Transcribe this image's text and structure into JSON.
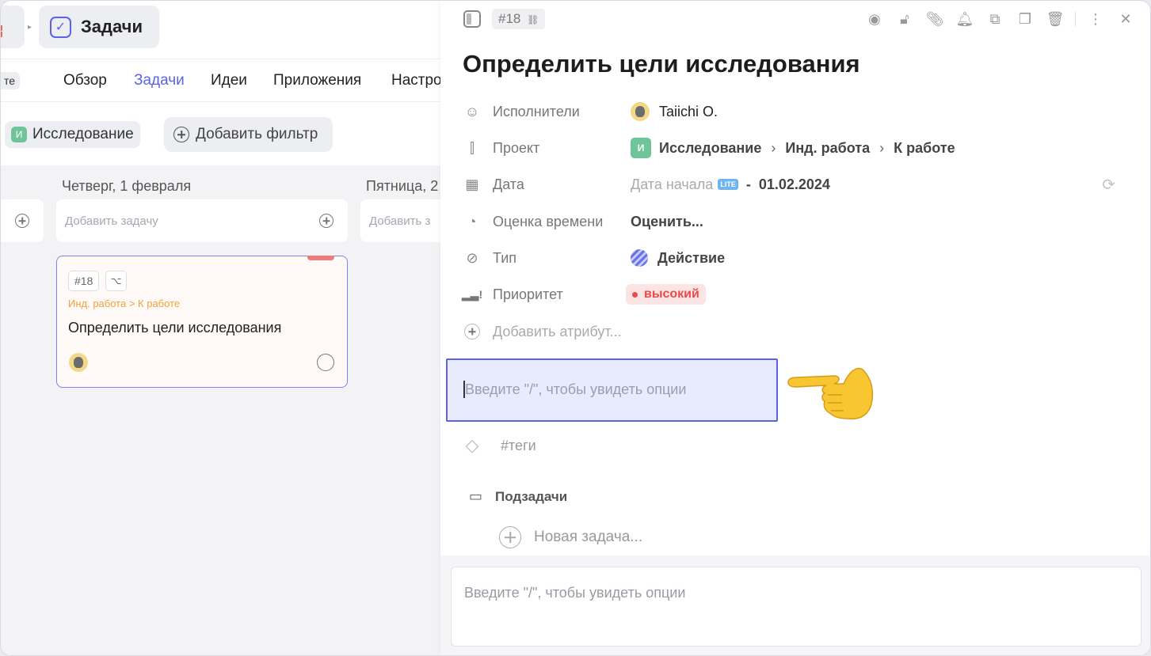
{
  "header": {
    "section_title": "Задачи",
    "stub_tag": "те"
  },
  "tabs": [
    {
      "label": "Обзор",
      "active": false
    },
    {
      "label": "Задачи",
      "active": true
    },
    {
      "label": "Идеи",
      "active": false
    },
    {
      "label": "Приложения",
      "active": false
    },
    {
      "label": "Настро",
      "active": false
    }
  ],
  "filters": {
    "project_badge": "И",
    "project_label": "Исследование",
    "add_filter_label": "Добавить фильтр"
  },
  "board": {
    "columns": [
      {
        "title": "Четверг, 1 февраля",
        "add_placeholder": "Добавить задачу"
      },
      {
        "title": "Пятница, 2",
        "add_placeholder": "Добавить з"
      }
    ],
    "card": {
      "id": "#18",
      "subtask_glyph": "⌥",
      "path": "Инд. работа > К работе",
      "title": "Определить цели исследования"
    }
  },
  "panel": {
    "id": "#18",
    "link_glyph": "🔗",
    "title": "Определить цели исследования",
    "attributes": {
      "assignees": {
        "label": "Исполнители",
        "value": "Taiichi O."
      },
      "project": {
        "label": "Проект",
        "badge": "И",
        "path": [
          "Исследование",
          "Инд. работа",
          "К работе"
        ]
      },
      "date": {
        "label": "Дата",
        "start_label": "Дата начала",
        "lite": "LITE",
        "separator": "-",
        "value": "01.02.2024"
      },
      "estimate": {
        "label": "Оценка времени",
        "value": "Оценить..."
      },
      "type": {
        "label": "Тип",
        "value": "Действие"
      },
      "priority": {
        "label": "Приоритет",
        "value": "высокий"
      },
      "add_attribute": "Добавить атрибут..."
    },
    "editor_placeholder": "Введите \"/\", чтобы увидеть опции",
    "tags_placeholder": "#теги",
    "subtasks_label": "Подзадачи",
    "new_task_label": "Новая задача...",
    "comment_placeholder": "Введите \"/\", чтобы увидеть опции"
  },
  "icons": {
    "top": [
      "eye-icon",
      "lock-icon",
      "paperclip-icon",
      "bell-icon",
      "hierarchy-icon",
      "copy-icon",
      "trash-icon",
      "more-icon",
      "close-icon"
    ],
    "chevron": "›",
    "sync": "⟳"
  },
  "colors": {
    "accent": "#5a63e8",
    "priority_high": "#e74b4b",
    "project_green": "#6fc49a",
    "path_orange": "#f0a23b"
  }
}
